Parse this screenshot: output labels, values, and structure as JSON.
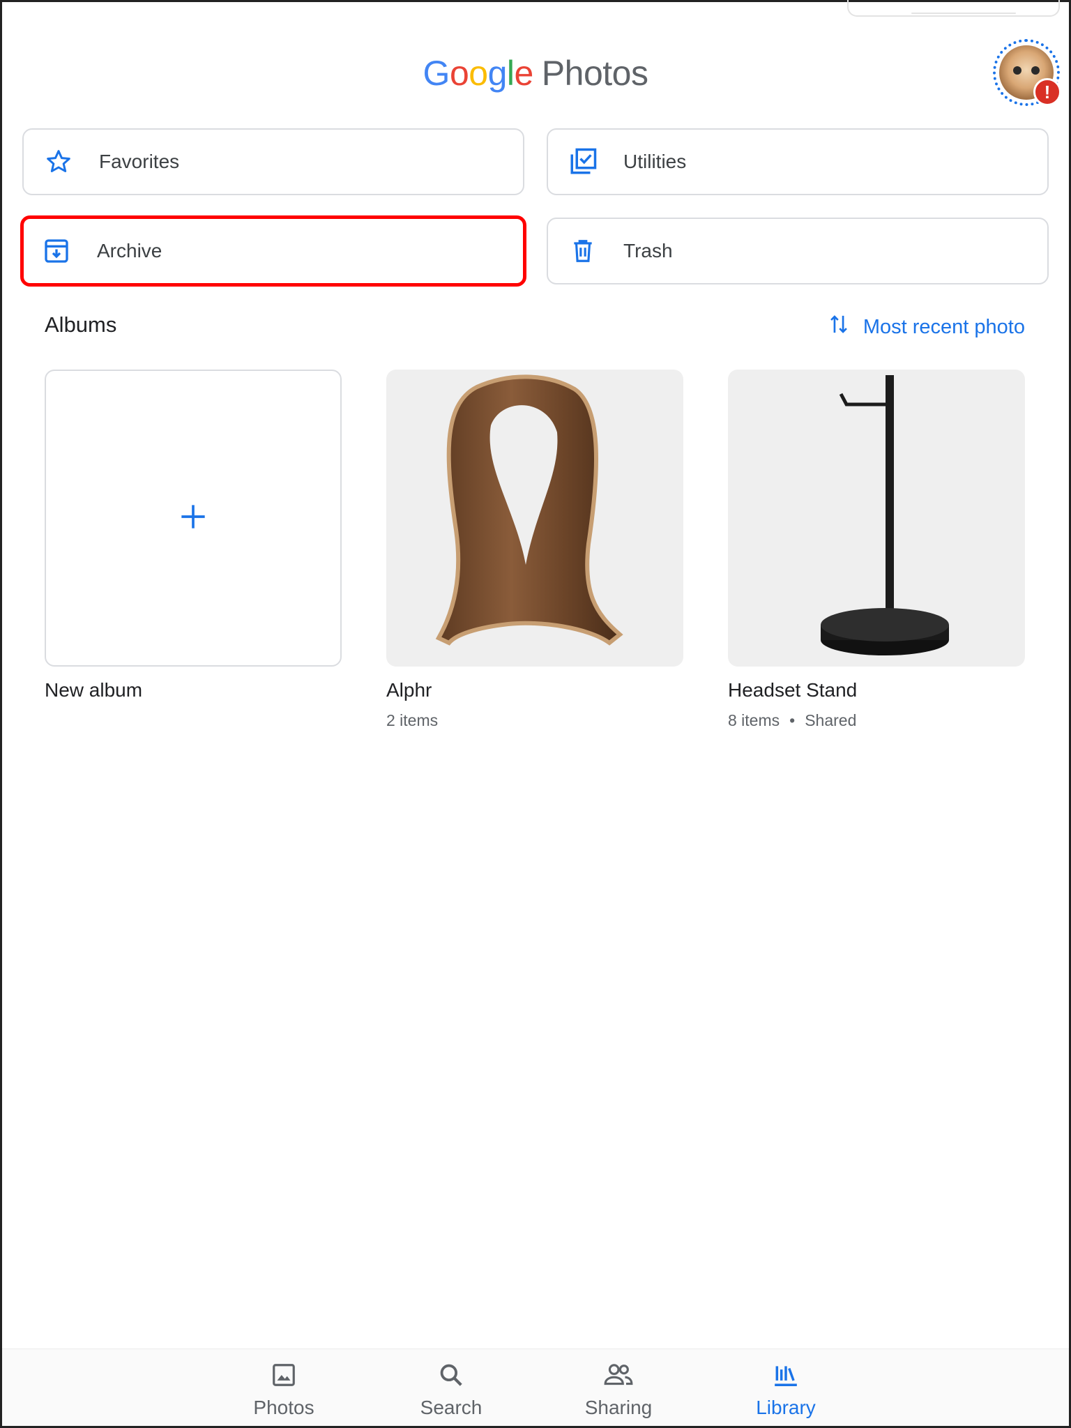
{
  "header": {
    "logo_google": [
      "G",
      "o",
      "o",
      "g",
      "l",
      "e"
    ],
    "logo_product": "Photos",
    "avatar_alert": "!"
  },
  "utilities": [
    {
      "label": "Favorites",
      "icon": "star-outline-icon"
    },
    {
      "label": "Utilities",
      "icon": "checkbox-stack-icon"
    },
    {
      "label": "Archive",
      "icon": "archive-box-icon",
      "highlighted": true
    },
    {
      "label": "Trash",
      "icon": "trash-icon"
    }
  ],
  "albums_section": {
    "title": "Albums",
    "sort_label": "Most recent photo",
    "sort_icon": "swap-vertical-icon"
  },
  "albums": [
    {
      "name": "New album",
      "meta": "",
      "thumb": "plus-icon"
    },
    {
      "name": "Alphr",
      "meta": "2 items",
      "thumb": "wooden-headphone-stand"
    },
    {
      "name": "Headset Stand",
      "meta": "8 items",
      "shared": "Shared",
      "separator": "•",
      "thumb": "black-headphone-stand"
    }
  ],
  "bottom_nav": [
    {
      "label": "Photos",
      "icon": "photo-icon",
      "active": false
    },
    {
      "label": "Search",
      "icon": "search-icon",
      "active": false
    },
    {
      "label": "Sharing",
      "icon": "people-icon",
      "active": false
    },
    {
      "label": "Library",
      "icon": "library-icon",
      "active": true
    }
  ],
  "colors": {
    "accent": "#1a73e8",
    "highlight": "#ff0000",
    "text": "#202124",
    "muted": "#5f6368",
    "border": "#dadce0"
  }
}
